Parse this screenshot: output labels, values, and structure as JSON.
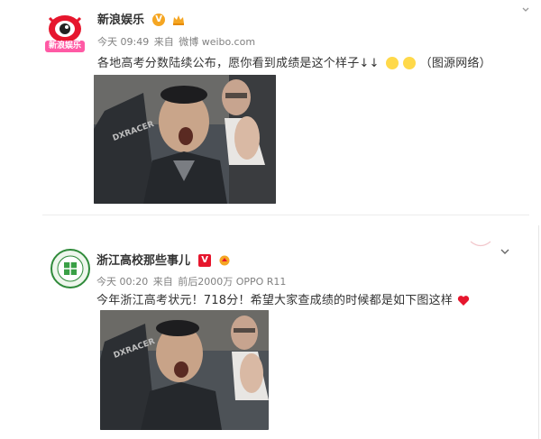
{
  "post1": {
    "author": "新浪娱乐",
    "avatar_text": "新浪娱乐",
    "badge": "V",
    "time": "今天 09:49",
    "source_prefix": "来自",
    "source": "微博 weibo.com",
    "text": "各地高考分数陆续公布，愿你看到成绩是这个样子↓↓",
    "text_tail": "（图源网络）",
    "image_watermark": "DXRACER"
  },
  "post2": {
    "author": "浙江高校那些事儿",
    "badge": "V",
    "time": "今天 00:20",
    "source_prefix": "来自",
    "source": "前后2000万 OPPO R11",
    "text": "今年浙江高考状元！718分！希望大家查成绩的时候都是如下图这样",
    "image_watermark": "DXRACER"
  },
  "icons": {
    "expand_1": "chevron-down-icon",
    "expand_2": "chevron-down-icon",
    "heart": "red-heart-icon"
  },
  "colors": {
    "name": "#333333",
    "meta": "#808080",
    "vip_badge": "#f5a623",
    "brand_red": "#e6162d",
    "heart": "#e6162d"
  }
}
